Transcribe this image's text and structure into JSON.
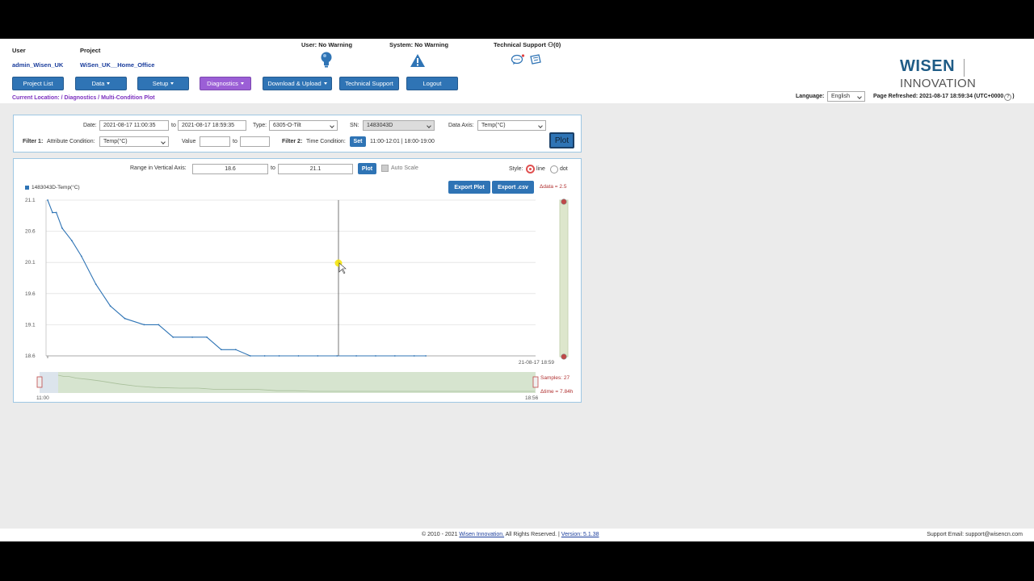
{
  "header": {
    "user_label": "User",
    "user_value": "admin_Wisen_UK",
    "project_label": "Project",
    "project_value": "WiSen_UK__Home_Office",
    "user_warning": "User: No Warning",
    "system_warning": "System: No Warning",
    "tech_support": "Technical Support",
    "tech_support_count": "(0)",
    "logo_brand": "WISEN",
    "logo_suffix": "INNOVATION"
  },
  "nav": [
    {
      "label": "Project List",
      "dropdown": false
    },
    {
      "label": "Data",
      "dropdown": true
    },
    {
      "label": "Setup",
      "dropdown": true
    },
    {
      "label": "Diagnostics",
      "dropdown": true
    },
    {
      "label": "Download & Upload",
      "dropdown": true
    },
    {
      "label": "Technical Support",
      "dropdown": false
    },
    {
      "label": "Logout",
      "dropdown": false
    }
  ],
  "location": "Current Location: / Diagnostics / Multi-Condition Plot",
  "language": {
    "label": "Language:",
    "value": "English"
  },
  "refreshed": "Page Refreshed: 2021-08-17 18:59:34 (UTC+0000",
  "refreshed_help": "?",
  "refreshed_close": ")",
  "filters": {
    "date_label": "Date:",
    "date_from": "2021-08-17 11:00:35",
    "to_label": "to",
    "date_to": "2021-08-17 18:59:35",
    "type_label": "Type:",
    "type_value": "6305-O-Tilt",
    "sn_label": "SN:",
    "sn_value": "1483043D",
    "data_axis_label": "Data Axis:",
    "data_axis_value": "Temp(°C)",
    "filter1_label": "Filter 1:",
    "attr_label": "Attribute Condition:",
    "attr_value": "Temp(°C)",
    "value_label": "Value",
    "value_to": "to",
    "filter2_label": "Filter 2:",
    "time_label": "Time Condition:",
    "set_label": "Set",
    "time_value": "11:00-12:01 | 18:00-19:00",
    "plot_label": "Plot"
  },
  "plot_controls": {
    "range_label": "Range in Vertical Axis:",
    "range_min": "18.6",
    "to_label": "to",
    "range_max": "21.1",
    "plot_btn": "Plot",
    "auto_scale": "Auto Scale",
    "style_label": "Style:",
    "style_line": "line",
    "style_dot": "dot",
    "export_plot": "Export Plot",
    "export_csv": "Export .csv",
    "delta_data": "Δdata = 2.5",
    "samples": "Samples: 27",
    "delta_time": "Δtime = 7.84h"
  },
  "chart_data": {
    "type": "line",
    "series": [
      {
        "name": "1483043D-Temp(°C)",
        "color": "#2f74b5"
      }
    ],
    "y_ticks": [
      "21.1",
      "20.6",
      "20.1",
      "19.6",
      "19.1",
      "18.6"
    ],
    "ylim": [
      18.6,
      21.1
    ],
    "x_end_label": "21-08-17 18:59",
    "nav_start": "11:00",
    "nav_end": "18:56",
    "x": [
      0,
      0.1,
      0.18,
      0.3,
      0.5,
      0.7,
      1.0,
      1.3,
      1.6,
      2.0,
      2.3,
      2.6,
      3.0,
      3.3,
      3.6,
      3.9,
      4.2,
      4.5,
      4.8,
      5.2,
      5.6,
      6.0,
      6.4,
      6.8,
      7.2,
      7.6,
      7.84
    ],
    "values": [
      21.1,
      20.9,
      20.9,
      20.65,
      20.45,
      20.2,
      19.75,
      19.4,
      19.2,
      19.1,
      19.1,
      18.9,
      18.9,
      18.9,
      18.7,
      18.7,
      18.6,
      18.6,
      18.6,
      18.6,
      18.6,
      18.6,
      18.6,
      18.6,
      18.6,
      18.6,
      18.6
    ]
  },
  "footer": {
    "copyright": "© 2010 - 2021",
    "company": "Wisen Innovation.",
    "rights": "All Rights Reserved. |",
    "version": "Version: 5.1.38",
    "support": "Support Email: support@wisencn.com"
  },
  "colors": {
    "accent": "#2f74b5",
    "diagnostics": "#9b5fd6",
    "location": "#7b2fbf"
  }
}
